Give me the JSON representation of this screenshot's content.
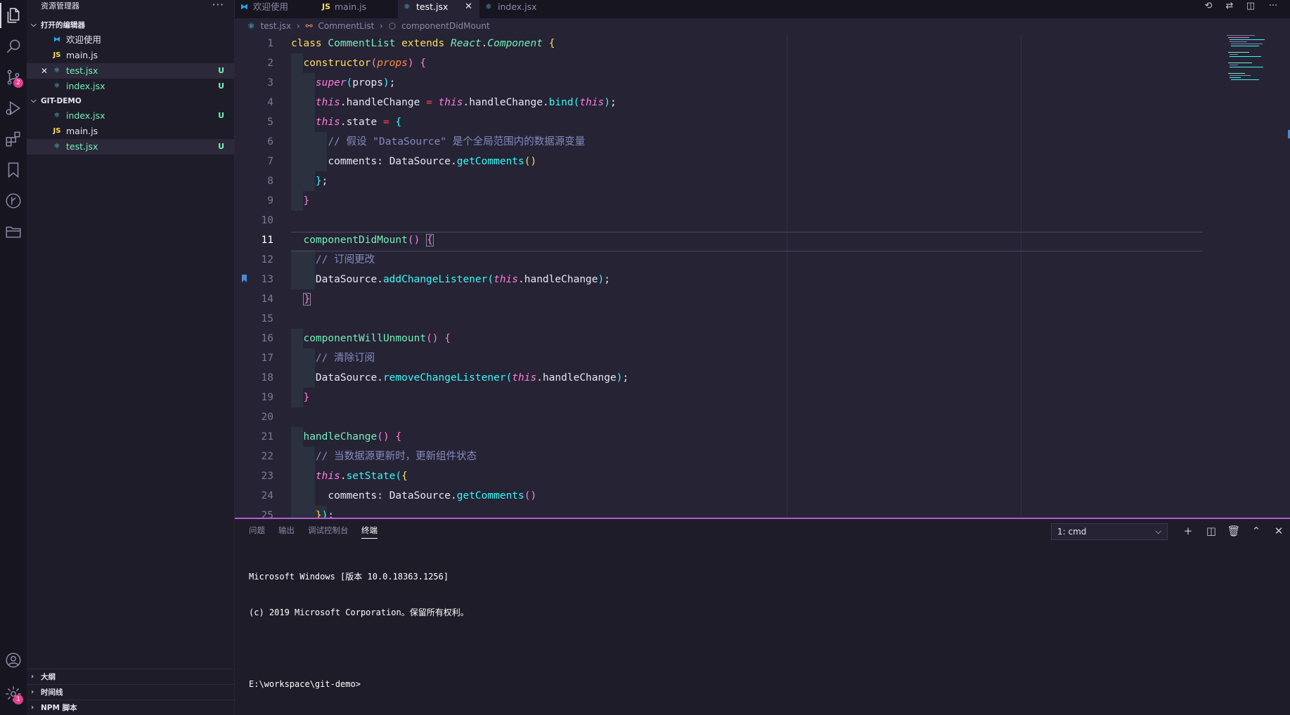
{
  "activity_bar": {
    "items": [
      {
        "name": "explorer",
        "icon": "files-icon"
      },
      {
        "name": "search",
        "icon": "search-icon"
      },
      {
        "name": "source-control",
        "icon": "source-control-icon",
        "badge": "2"
      },
      {
        "name": "run",
        "icon": "run-debug-icon"
      },
      {
        "name": "extensions",
        "icon": "extensions-icon"
      },
      {
        "name": "bookmarks",
        "icon": "bookmark-icon"
      },
      {
        "name": "git-graph",
        "icon": "git-history-icon"
      },
      {
        "name": "project-manager",
        "icon": "folder-icon"
      }
    ],
    "account_icon": "account-icon",
    "settings_badge": "1"
  },
  "sidebar": {
    "title": "资源管理器",
    "more": "···",
    "open_editors": {
      "title": "打开的编辑器",
      "items": [
        {
          "label": "欢迎使用",
          "icon": "vscode-icon",
          "status": ""
        },
        {
          "label": "main.js",
          "icon": "JS",
          "status": ""
        },
        {
          "label": "test.jsx",
          "icon": "react-icon",
          "status": "U"
        },
        {
          "label": "index.jsx",
          "icon": "react-icon",
          "status": "U"
        }
      ]
    },
    "workspace": {
      "title": "GIT-DEMO",
      "items": [
        {
          "label": "index.jsx",
          "icon": "react-icon",
          "status": "U"
        },
        {
          "label": "main.js",
          "icon": "JS",
          "status": ""
        },
        {
          "label": "test.jsx",
          "icon": "react-icon",
          "status": "U"
        }
      ]
    },
    "bottom_sections": [
      "大纲",
      "时间线",
      "NPM 脚本"
    ]
  },
  "tabs": [
    {
      "label": "欢迎使用",
      "icon": "vscode-icon"
    },
    {
      "label": "main.js",
      "icon": "JS"
    },
    {
      "label": "test.jsx",
      "icon": "react-icon",
      "active": true
    },
    {
      "label": "index.jsx",
      "icon": "react-icon"
    }
  ],
  "breadcrumb": [
    "test.jsx",
    "CommentList",
    "componentDidMount"
  ],
  "editor": {
    "current_line": 11,
    "bookmark_line": 13,
    "line_numbers": [
      "1",
      "2",
      "3",
      "4",
      "5",
      "6",
      "7",
      "8",
      "9",
      "10",
      "11",
      "12",
      "13",
      "14",
      "15",
      "16",
      "17",
      "18",
      "19",
      "20",
      "21",
      "22",
      "23",
      "24",
      "25"
    ]
  },
  "panel": {
    "tabs": [
      "问题",
      "输出",
      "调试控制台",
      "终端"
    ],
    "active_tab": "终端",
    "terminal_select": "1: cmd",
    "terminal_lines": [
      "Microsoft Windows [版本 10.0.18363.1256]",
      "(c) 2019 Microsoft Corporation。保留所有权利。",
      "",
      "E:\\workspace\\git-demo>"
    ]
  },
  "colors": {
    "accent": "#b45ad7",
    "untracked": "#72f1b8",
    "badge": "#e43f8c"
  }
}
